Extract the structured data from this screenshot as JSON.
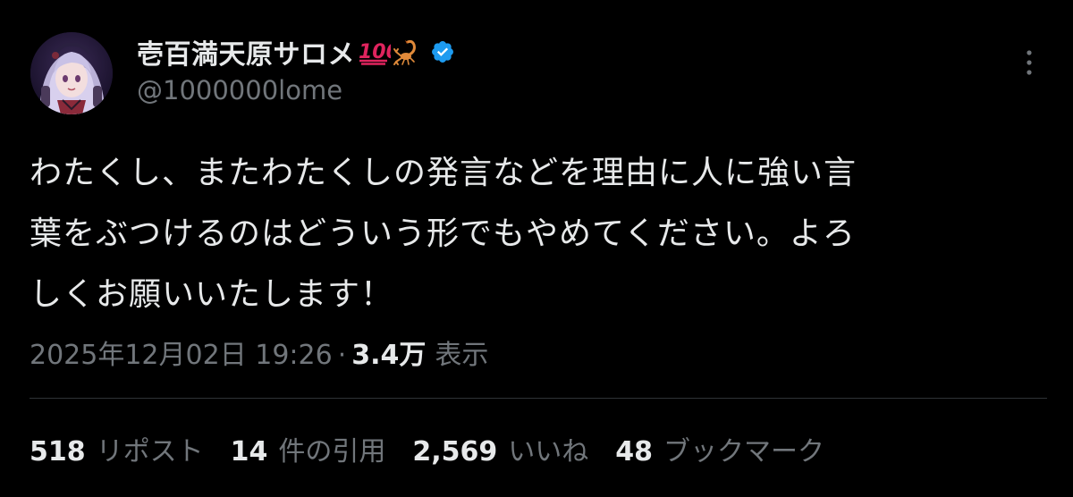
{
  "tweet": {
    "display_name": "壱百満天原サロメ",
    "emoji_100_icon": "hundred-points-emoji",
    "emoji_scorpion_icon": "scorpion-emoji",
    "verified_icon": "verified-badge",
    "handle": "@1000000lome",
    "more_icon": "vertical-ellipsis",
    "text_lines": [
      "わたくし、またわたくしの発言などを理由に人に強い言",
      "葉をぶつけるのはどういう形でもやめてください。よろ",
      "しくお願いいたします！"
    ],
    "timestamp": "2025年12月02日 19:26",
    "separator": "·",
    "views_count": "3.4万",
    "views_label": "表示"
  },
  "stats": {
    "reposts_count": "518",
    "reposts_label": "リポスト",
    "quotes_count": "14",
    "quotes_label": "件の引用",
    "likes_count": "2,569",
    "likes_label": "いいね",
    "bookmarks_count": "48",
    "bookmarks_label": "ブックマーク"
  },
  "colors": {
    "background": "#000000",
    "primary_text": "#e7e9ea",
    "secondary_text": "#71767b",
    "verified_blue": "#1d9bf0",
    "divider": "#2f3336"
  }
}
